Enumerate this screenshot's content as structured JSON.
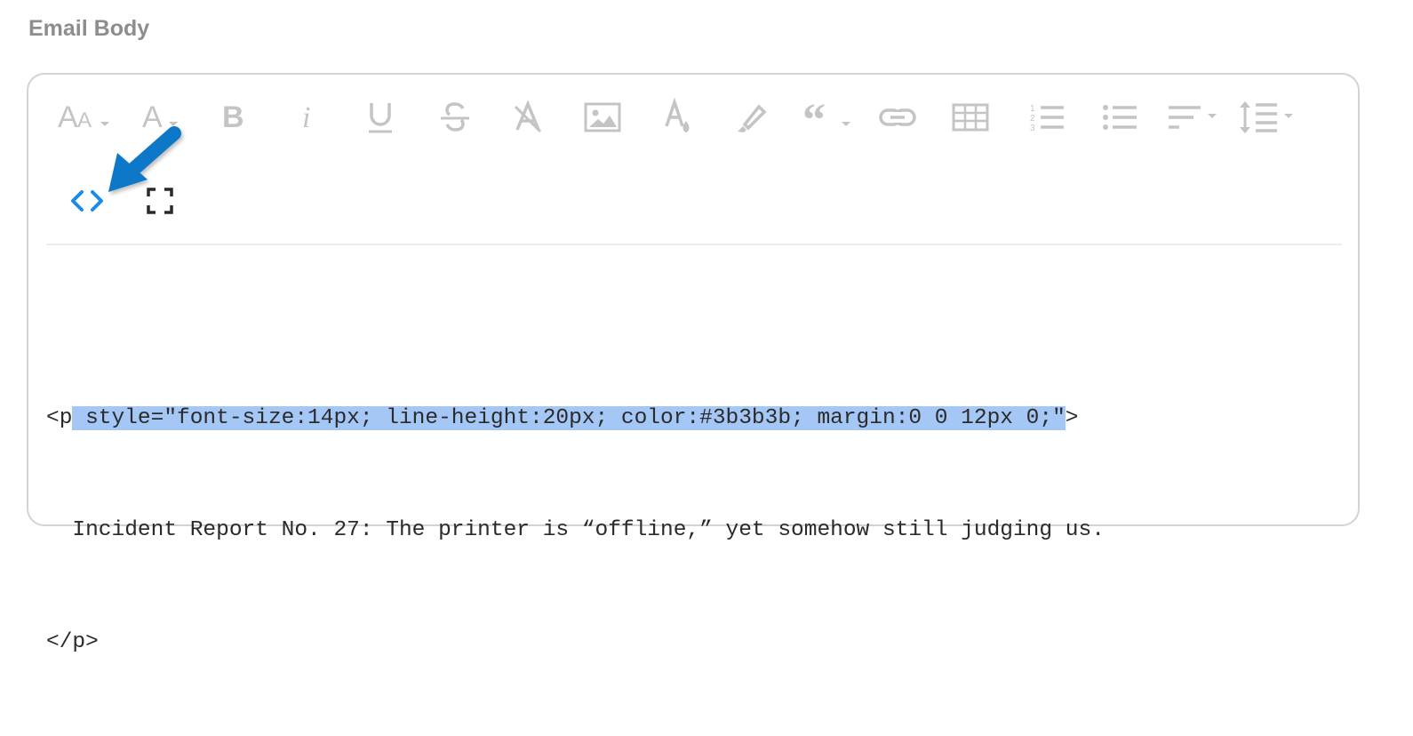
{
  "field": {
    "label": "Email Body"
  },
  "toolbar": {
    "row1": [
      {
        "name": "font-family-icon",
        "dropdown": true
      },
      {
        "name": "font-size-icon",
        "dropdown": true
      },
      {
        "name": "bold-icon"
      },
      {
        "name": "italic-icon"
      },
      {
        "name": "underline-icon"
      },
      {
        "name": "strikethrough-icon"
      },
      {
        "name": "clear-formatting-icon"
      },
      {
        "name": "image-icon"
      },
      {
        "name": "text-color-icon"
      },
      {
        "name": "highlight-icon"
      },
      {
        "name": "quote-icon",
        "dropdown": true
      },
      {
        "name": "link-icon"
      },
      {
        "name": "table-icon"
      },
      {
        "name": "ordered-list-icon"
      },
      {
        "name": "unordered-list-icon"
      },
      {
        "name": "align-icon",
        "dropdown": true
      },
      {
        "name": "line-height-icon",
        "dropdown": true
      }
    ],
    "row2": [
      {
        "name": "code-view-icon",
        "active": true
      },
      {
        "name": "fullscreen-icon"
      }
    ],
    "icon_color": "#c4c4c4",
    "active_color": "#1a8ce8"
  },
  "code": {
    "line1_open": "<p",
    "line1_selected": " style=\"font-size:14px; line-height:20px; color:#3b3b3b; margin:0 0 12px 0;\"",
    "line1_close": ">",
    "line2": "  Incident Report No. 27: The printer is “offline,” yet somehow still judging us.",
    "line3": "</p>",
    "selection_color": "#a4c7f6"
  },
  "annotation": {
    "arrow_color": "#0a78c8",
    "points_to": "code-view-icon"
  }
}
